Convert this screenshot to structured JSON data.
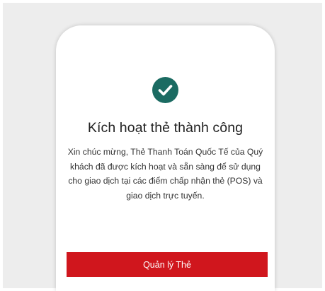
{
  "dialog": {
    "title": "Kích hoạt thẻ thành công",
    "message": "Xin chúc mừng, Thẻ Thanh Toán Quốc Tế của Quý khách đã được kích hoạt và sẵn sàng để sử dụng cho giao dịch tại các điểm chấp nhận thẻ (POS) và giao dịch trực tuyến.",
    "button_label": "Quản lý Thẻ",
    "icon": "success-check-icon"
  },
  "colors": {
    "background": "#ededed",
    "card": "#ffffff",
    "success_icon": "#1b6b62",
    "button": "#d0161d",
    "button_text": "#ffffff"
  }
}
